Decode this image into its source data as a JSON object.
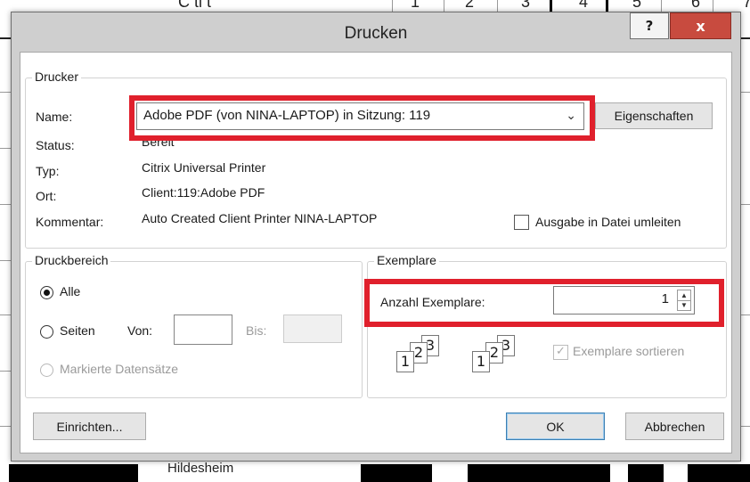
{
  "background": {
    "header_text": "C ti t",
    "column_numbers": [
      "1",
      "2",
      "3",
      "4",
      "5",
      "6",
      "7"
    ],
    "city": "Hildesheim"
  },
  "dialog": {
    "title": "Drucken",
    "help_label": "?",
    "close_label": "x",
    "printer": {
      "group_label": "Drucker",
      "name_label": "Name:",
      "name_value": "Adobe PDF (von NINA-LAPTOP) in Sitzung: 119",
      "properties_button": "Eigenschaften",
      "status_label": "Status:",
      "status_value": "Bereit",
      "type_label": "Typ:",
      "type_value": "Citrix Universal Printer",
      "location_label": "Ort:",
      "location_value": "Client:119:Adobe PDF",
      "comment_label": "Kommentar:",
      "comment_value": "Auto Created Client Printer NINA-LAPTOP",
      "print_to_file_label": "Ausgabe in Datei umleiten",
      "print_to_file_checked": false
    },
    "range": {
      "group_label": "Druckbereich",
      "all_label": "Alle",
      "pages_label": "Seiten",
      "from_label": "Von:",
      "to_label": "Bis:",
      "selection_label": "Markierte Datensätze",
      "selected": "all"
    },
    "copies": {
      "group_label": "Exemplare",
      "count_label": "Anzahl Exemplare:",
      "count_value": "1",
      "collate_label": "Exemplare sortieren",
      "collate_checked": true,
      "icon_pages": [
        "1",
        "2",
        "3"
      ]
    },
    "buttons": {
      "setup": "Einrichten...",
      "ok": "OK",
      "cancel": "Abbrechen"
    },
    "highlight_color": "#e0202c"
  }
}
